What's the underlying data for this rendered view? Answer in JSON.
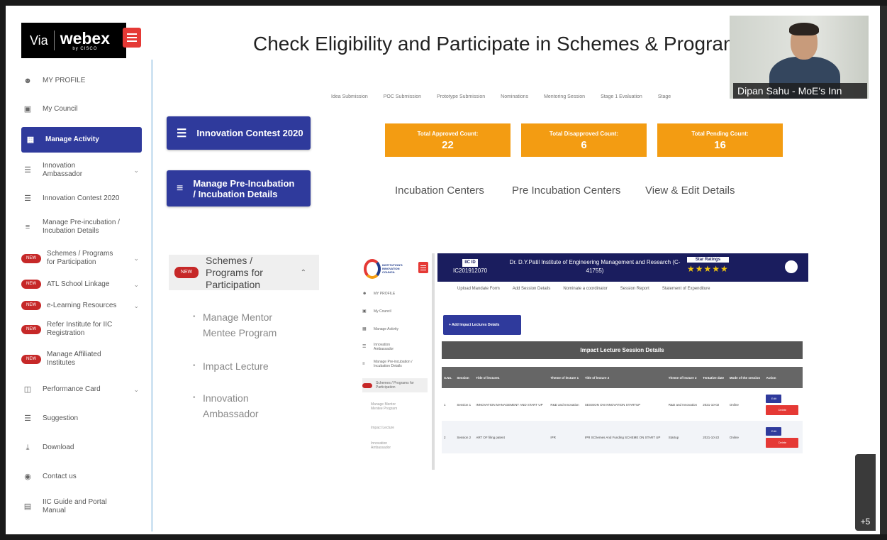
{
  "webex": {
    "via": "Via",
    "brand": "webex",
    "sub": "by CISCO"
  },
  "title": "Check Eligibility and Participate in Schemes & Program",
  "sidebar": {
    "items": [
      {
        "label": "MY PROFILE",
        "icon": "user-icon"
      },
      {
        "label": "My Council",
        "icon": "council-icon"
      },
      {
        "label": "Manage Activity",
        "icon": "grid-icon"
      },
      {
        "label": "Innovation Ambassador",
        "icon": "list-icon"
      },
      {
        "label": "Innovation Contest 2020",
        "icon": "list-icon"
      },
      {
        "label": "Manage Pre-incubation / Incubation Details",
        "icon": "layers-icon"
      },
      {
        "label": "Schemes / Programs for Participation",
        "icon": "new-badge"
      },
      {
        "label": "ATL School Linkage",
        "icon": "new-badge"
      },
      {
        "label": "e-Learning Resources",
        "icon": "new-badge"
      },
      {
        "label": "Refer Institute for IIC Registration",
        "icon": "new-badge"
      },
      {
        "label": "Manage Affiliated Institutes",
        "icon": "new-badge"
      },
      {
        "label": "Performance Card",
        "icon": "chart-icon"
      },
      {
        "label": "Suggestion",
        "icon": "menu-icon"
      },
      {
        "label": "Download",
        "icon": "download-icon"
      },
      {
        "label": "Contact us",
        "icon": "location-icon"
      },
      {
        "label": "IIC Guide and Portal Manual",
        "icon": "book-icon"
      }
    ]
  },
  "buttons": {
    "innovation_contest": "Innovation Contest 2020",
    "manage_pre_incubation": "Manage Pre-Incubation / Incubation Details"
  },
  "schemes": {
    "badge": "NEW",
    "label": "Schemes / Programs for Participation",
    "sub_links": [
      "Manage Mentor Mentee Program",
      "Impact Lecture",
      "Innovation Ambassador"
    ]
  },
  "tabs": [
    "Idea Submission",
    "POC Submission",
    "Prototype Submission",
    "Nominations",
    "Mentoring Session",
    "Stage 1 Evaluation",
    "Stage"
  ],
  "counts": [
    {
      "label": "Total Approved Count:",
      "value": "22"
    },
    {
      "label": "Total Disapproved Count:",
      "value": "6"
    },
    {
      "label": "Total Pending Count:",
      "value": "16"
    }
  ],
  "center_links": [
    "Incubation Centers",
    "Pre Incubation Centers",
    "View & Edit Details"
  ],
  "inner": {
    "logo_text": "INSTITUTION'S INNOVATION COUNCIL",
    "side_items": [
      "MY PROFILE",
      "My Council",
      "Manage Activity",
      "Innovation Ambassador",
      "Manage Pre-incubation / Incubation Details",
      "Schemes / Programs for Participation",
      "Manage Mentor Mentee Program",
      "Impact Lecture",
      "Innovation Ambassador"
    ],
    "ic_id_label": "IIC ID",
    "ic_id": "IC201912070",
    "institute": "Dr. D.Y.Patil Institute of Engineering Management and Research (C-41755)",
    "star_label": "Star Ratings",
    "stars": "★★★★★",
    "tabs": [
      "Upload Mandate Form",
      "Add Session Details",
      "Nominate a coordinator",
      "Session Report",
      "Statement of Expenditure"
    ],
    "add_button": "+ Add Impact Lectures Details",
    "session_title": "Impact Lecture Session Details",
    "table_headers": [
      "S.No.",
      "Session",
      "Title of lecture1",
      "Theme of lecture 1",
      "Title of lecture 2",
      "Theme of lecture 2",
      "Tentative date",
      "Mode of the session",
      "Action"
    ],
    "rows": [
      [
        "1",
        "Session 1",
        "INNOVATION MANAGEMENT AND START UP",
        "R&D and Innovation",
        "SESSION ON INNOVATION STARTUP",
        "R&D and Innovation",
        "2021-10-02",
        "Online"
      ],
      [
        "2",
        "Session 2",
        "ART OF filing patent",
        "IPR",
        "IPR SChemes And Funding SCHEME ON START UP",
        "Startup",
        "2021-10-22",
        "Online"
      ]
    ],
    "edit_label": "Edit",
    "delete_label": "Delete"
  },
  "video": {
    "name": "Dipan Sahu - MoE's Inn"
  },
  "more_participants": "+5",
  "colors": {
    "primary": "#2f3a9c",
    "orange": "#f39c12",
    "red": "#e53935",
    "header": "#1a1d5e"
  }
}
